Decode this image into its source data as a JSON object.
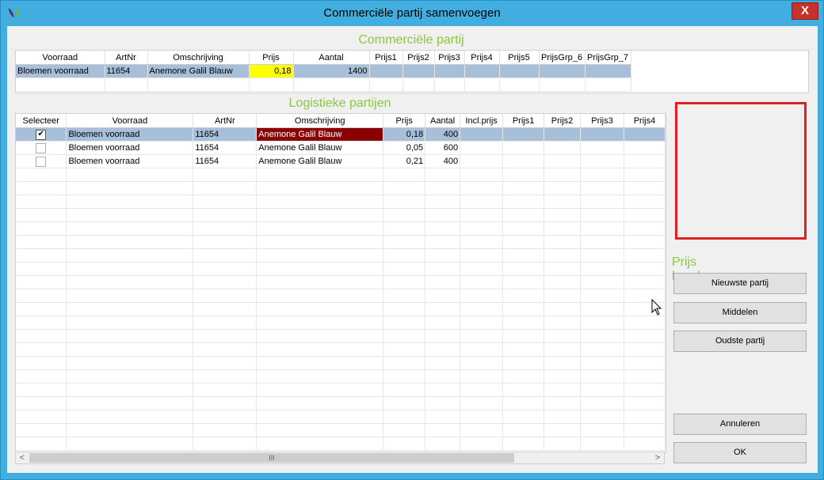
{
  "window": {
    "title": "Commerciële partij samenvoegen",
    "close_glyph": "X"
  },
  "commercial": {
    "title": "Commerciële partij",
    "columns": [
      "Voorraad",
      "ArtNr",
      "Omschrijving",
      "Prijs",
      "Aantal",
      "Prijs1",
      "Prijs2",
      "Prijs3",
      "Prijs4",
      "Prijs5",
      "PrijsGrp_6",
      "PrijsGrp_7"
    ],
    "rows": [
      {
        "voorraad": "Bloemen voorraad",
        "artnr": "11654",
        "omschrijving": "Anemone Galil Blauw",
        "prijs": "0,18",
        "aantal": "1400"
      }
    ]
  },
  "logistic": {
    "title": "Logistieke partijen",
    "columns": [
      "Selecteer",
      "Voorraad",
      "ArtNr",
      "Omschrijving",
      "Prijs",
      "Aantal",
      "Incl.prijs",
      "Prijs1",
      "Prijs2",
      "Prijs3",
      "Prijs4"
    ],
    "rows": [
      {
        "checked": true,
        "check_glyph": "✔",
        "voorraad": "Bloemen voorraad",
        "artnr": "11654",
        "omschrijving": "Anemone Galil Blauw",
        "prijs": "0,18",
        "aantal": "400"
      },
      {
        "checked": false,
        "check_glyph": "",
        "voorraad": "Bloemen voorraad",
        "artnr": "11654",
        "omschrijving": "Anemone Galil Blauw",
        "prijs": "0,05",
        "aantal": "600"
      },
      {
        "checked": false,
        "check_glyph": "",
        "voorraad": "Bloemen voorraad",
        "artnr": "11654",
        "omschrijving": "Anemone Galil Blauw",
        "prijs": "0,21",
        "aantal": "400"
      }
    ]
  },
  "price_calc": {
    "title": "Prijs berekenen",
    "newest_label": "Nieuwste partij",
    "average_label": "Middelen",
    "oldest_label": "Oudste partij"
  },
  "footer": {
    "cancel_label": "Annuleren",
    "ok_label": "OK"
  },
  "scrollbar": {
    "left_glyph": "<",
    "right_glyph": ">",
    "grip_glyph": "III"
  },
  "colors": {
    "title_bar": "#41aedf",
    "section_title": "#8cc63e",
    "selected_row": "#a8bfd9",
    "price_highlight": "#ffff00",
    "description_highlight": "#8b0000",
    "frame_outline": "#e02020"
  }
}
